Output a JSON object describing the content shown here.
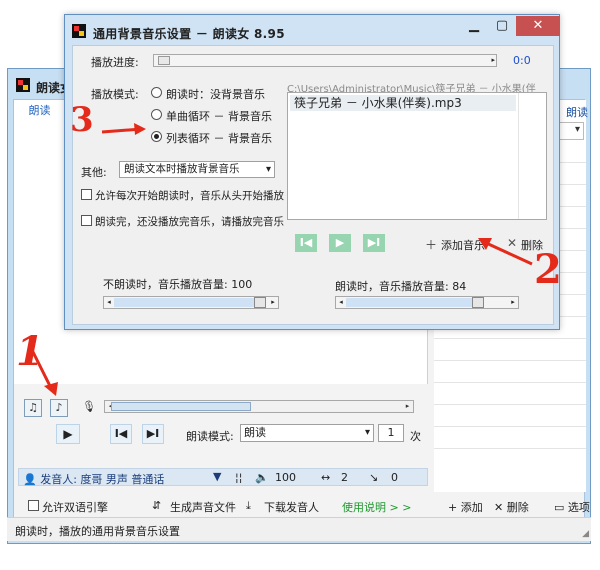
{
  "main_window": {
    "title": "朗读女",
    "tab_label": "朗读",
    "right_top_text": "朗读吗？",
    "seek": {
      "left_arrow": "◂",
      "right_arrow": "▸"
    },
    "play": "▶",
    "prev": "I◀",
    "next": "▶I",
    "read_mode_label": "朗读模式:",
    "read_mode_value": "朗读",
    "repeat_count": "1",
    "repeat_unit": "次",
    "speaker_label": "👤 发音人: 度哥 男声 普通话",
    "volume": "100",
    "speed": "2",
    "pitch": "0",
    "engine_label": "允许双语引擎",
    "gen_audio_label": "生成声音文件",
    "download_voice_label": "下载发音人",
    "help_link": "使用说明 > >",
    "add_label": "添加",
    "delete_label": "删除",
    "options_label": "选项",
    "status": "朗读时，播放的通用背景音乐设置"
  },
  "dialog": {
    "title": "通用背景音乐设置 － 朗读女 8.95",
    "progress_label": "播放进度:",
    "time": "0:0",
    "mode_label": "播放模式:",
    "modes": [
      {
        "label": "朗读时：没背景音乐",
        "selected": false
      },
      {
        "label": "单曲循环 － 背景音乐",
        "selected": false
      },
      {
        "label": "列表循环 － 背景音乐",
        "selected": true
      }
    ],
    "other_label": "其他:",
    "other_value": "朗读文本时播放背景音乐",
    "options": [
      {
        "label": "允许每次开始朗读时，音乐从头开始播放",
        "checked": false
      },
      {
        "label": "朗读完，还没播放完音乐，请播放完音乐",
        "checked": false
      }
    ],
    "path": "C:\\Users\\Administrator\\Music\\筷子兄弟 － 小水果(伴",
    "playlist": [
      "筷子兄弟 － 小水果(伴奏).mp3"
    ],
    "add_music_label": "添加音乐",
    "delete_music_label": "删除",
    "idle_volume_label": "不朗读时，音乐播放音量: 100",
    "idle_volume": 100,
    "reading_volume_label": "朗读时，音乐播放音量: 84",
    "reading_volume": 84
  },
  "annotations": [
    "1",
    "2",
    "3"
  ],
  "colors": {
    "annotation": "#e42a1a",
    "accent": "#1b4fd0",
    "play_green": "#97d4b0"
  }
}
